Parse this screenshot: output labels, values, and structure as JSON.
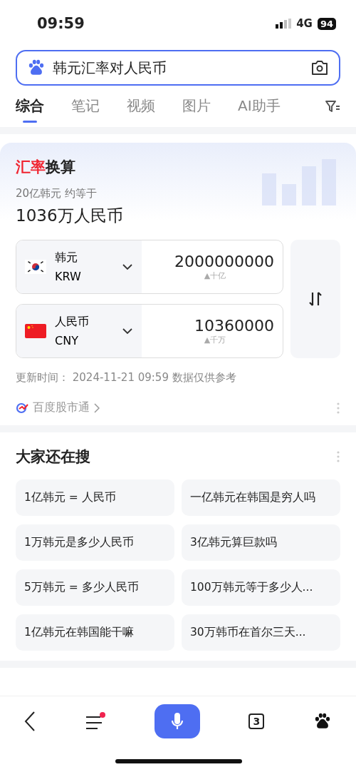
{
  "status_bar": {
    "time": "09:59",
    "network": "4G",
    "battery": "94"
  },
  "search": {
    "value": "韩元汇率对人民币"
  },
  "tabs": [
    {
      "label": "综合",
      "selected": true
    },
    {
      "label": "笔记",
      "selected": false
    },
    {
      "label": "视频",
      "selected": false
    },
    {
      "label": "图片",
      "selected": false
    },
    {
      "label": "AI助手",
      "selected": false
    }
  ],
  "converter": {
    "title": [
      {
        "text": "汇率",
        "highlight": true
      },
      {
        "text": "换算",
        "highlight": false
      }
    ],
    "summary": "20亿韩元 约等于",
    "result": "1036万人民币",
    "rows": [
      {
        "name": "韩元",
        "code": "KRW",
        "kind": "kr",
        "amount": "2000000000",
        "unit": "▲十亿"
      },
      {
        "name": "人民币",
        "code": "CNY",
        "kind": "cn",
        "amount": "10360000",
        "unit": "▲千万"
      }
    ],
    "updated": "更新时间： 2024-11-21 09:59 数据仅供参考",
    "source": "百度股市通"
  },
  "related": {
    "title": "大家还在搜",
    "items": [
      "1亿韩元 = 人民币",
      "一亿韩元在韩国是穷人吗",
      "1万韩元是多少人民币",
      "3亿韩元算巨款吗",
      "5万韩元 = 多少人民币",
      "100万韩元等于多少人...",
      "1亿韩元在韩国能干嘛",
      "30万韩币在首尔三天..."
    ]
  },
  "bottom_nav": {
    "menu_badge": true,
    "tab_count": "3"
  }
}
